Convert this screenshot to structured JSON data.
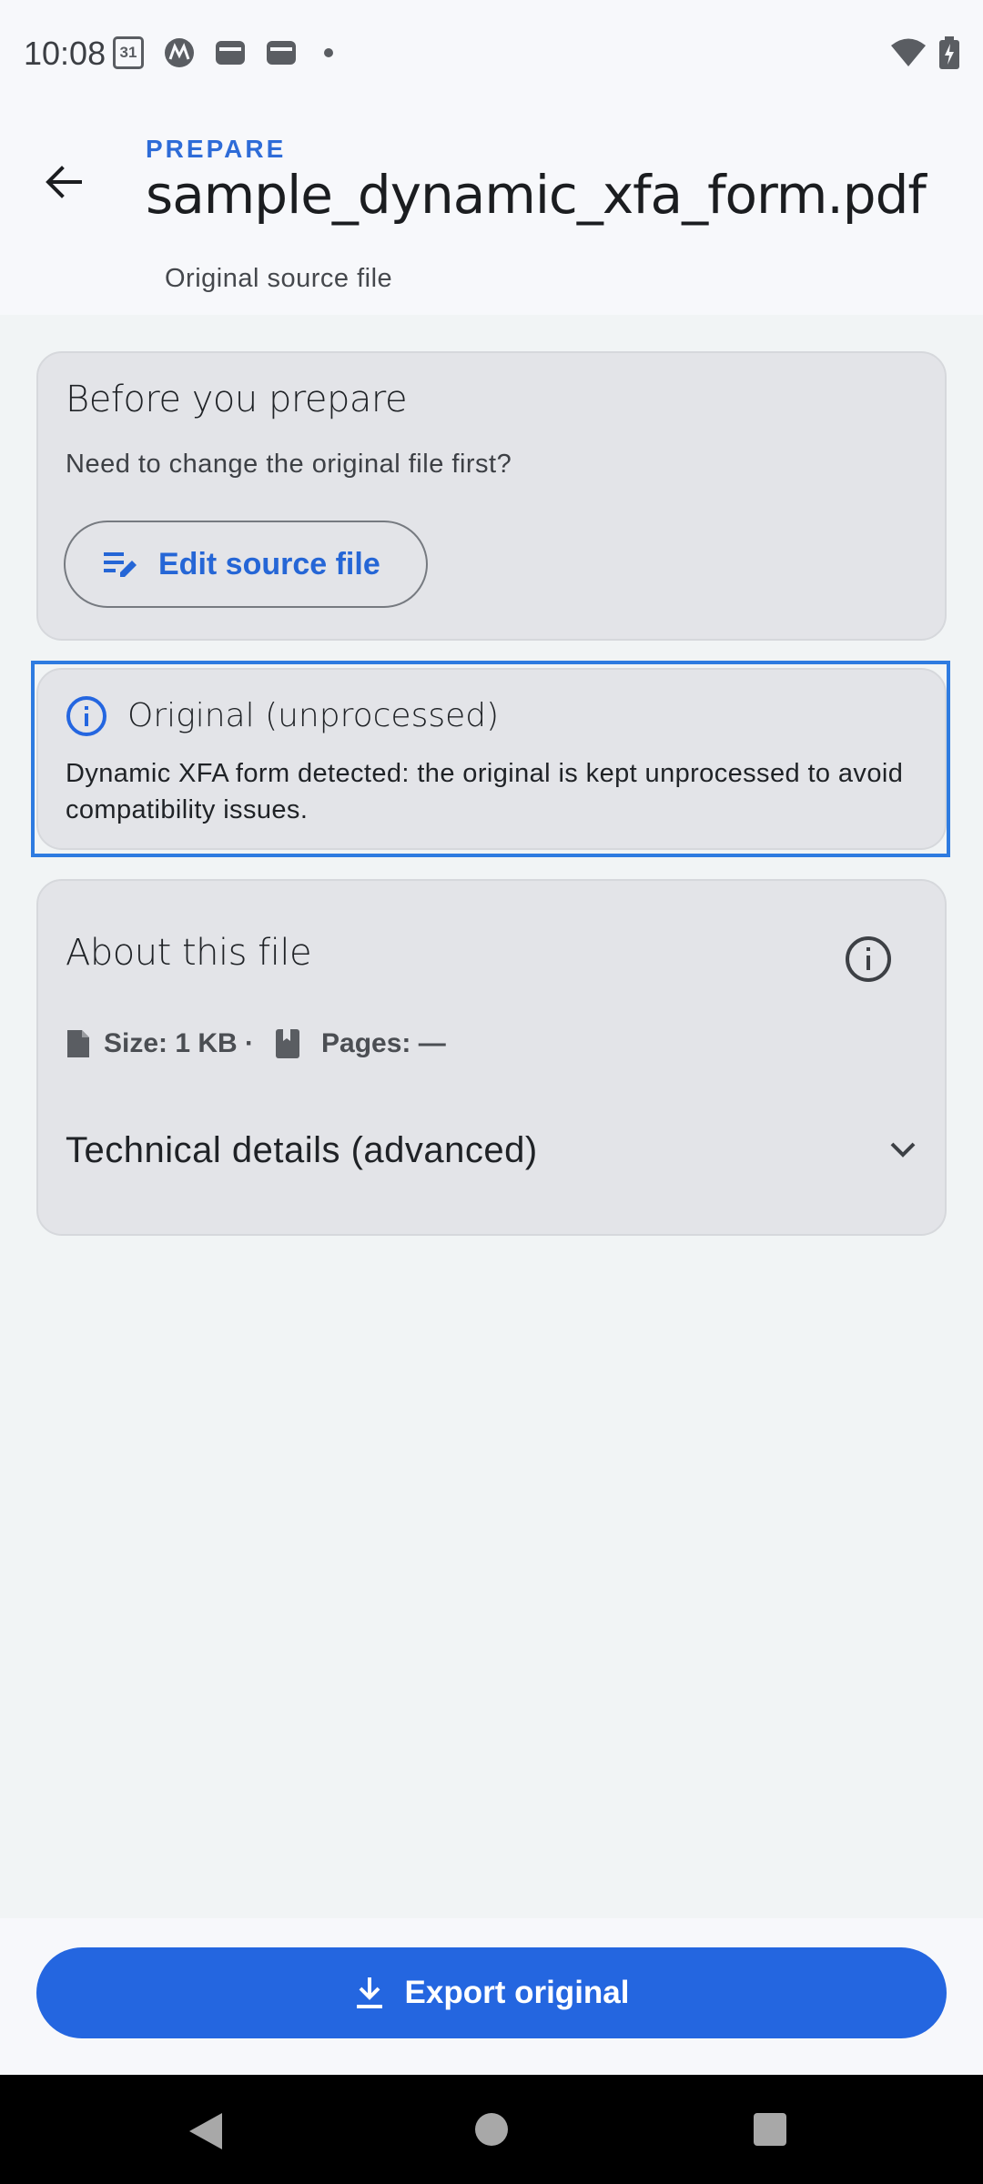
{
  "status_bar": {
    "time": "10:08",
    "calendar_badge": "31"
  },
  "header": {
    "eyebrow": "PREPARE",
    "title": "sample_dynamic_xfa_form.pdf",
    "subtitle": "Original source file"
  },
  "prepare_card": {
    "title": "Before you prepare",
    "text": "Need to change the original file first?",
    "edit_button": "Edit source file"
  },
  "notice": {
    "title": "Original (unprocessed)",
    "body": "Dynamic XFA form detected: the original is kept unprocessed to avoid compatibility issues."
  },
  "about_card": {
    "title": "About this file",
    "size": "Size: 1 KB ·",
    "pages": "Pages: —",
    "technical": "Technical details (advanced)"
  },
  "bottom": {
    "export_button": "Export original"
  },
  "colors": {
    "accent": "#2466e0",
    "focus_outline": "#2e7be0",
    "card_bg": "#e3e4e8"
  },
  "icons": {
    "back": "arrow-left-icon",
    "edit": "edit-note-icon",
    "notice": "info-circle-icon",
    "about_info": "info-circle-outline-icon",
    "size": "file-icon",
    "pages": "book-icon",
    "expand": "chevron-down-icon",
    "export": "download-icon"
  }
}
